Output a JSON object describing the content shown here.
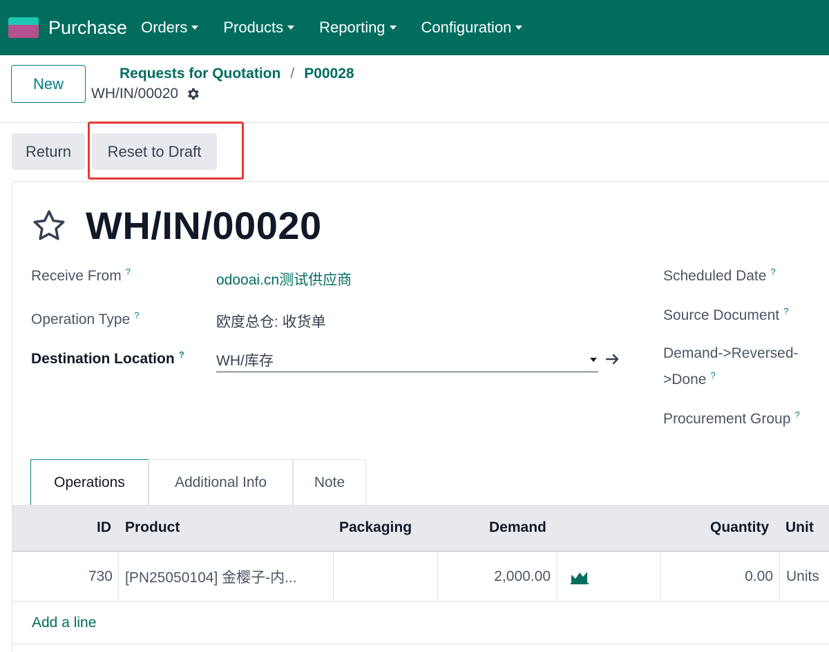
{
  "navbar": {
    "app_name": "Purchase",
    "menus": [
      "Orders",
      "Products",
      "Reporting",
      "Configuration"
    ]
  },
  "control_panel": {
    "new_label": "New",
    "breadcrumb": [
      "Requests for Quotation",
      "P00028"
    ],
    "breadcrumb_sep": "/",
    "current_record": "WH/IN/00020"
  },
  "statusbar": {
    "return_label": "Return",
    "reset_label": "Reset to Draft"
  },
  "form": {
    "title": "WH/IN/00020",
    "tip_mark": "?",
    "fields_left": [
      {
        "label": "Receive From",
        "value": "odooai.cn测试供应商"
      },
      {
        "label": "Operation Type",
        "value": "欧度总仓: 收货单"
      },
      {
        "label": "Destination Location",
        "value": "WH/库存"
      }
    ],
    "fields_right": [
      {
        "label": "Scheduled Date"
      },
      {
        "label": "Source Document"
      },
      {
        "label_line1": "Demand->Reversed-",
        "label_line2": ">Done"
      },
      {
        "label": "Procurement Group"
      }
    ]
  },
  "tabs": [
    "Operations",
    "Additional Info",
    "Note"
  ],
  "table": {
    "headers": {
      "id": "ID",
      "product": "Product",
      "packaging": "Packaging",
      "demand": "Demand",
      "quantity": "Quantity",
      "unit": "Unit"
    },
    "rows": [
      {
        "id": "730",
        "product": "[PN25050104] 金樱子-内...",
        "packaging": "",
        "demand": "2,000.00",
        "quantity": "0.00",
        "unit": "Units"
      }
    ],
    "add_line": "Add a line"
  },
  "colors": {
    "brand": "#016d5f",
    "accent": "#017e84",
    "highlight": "#e53935"
  }
}
